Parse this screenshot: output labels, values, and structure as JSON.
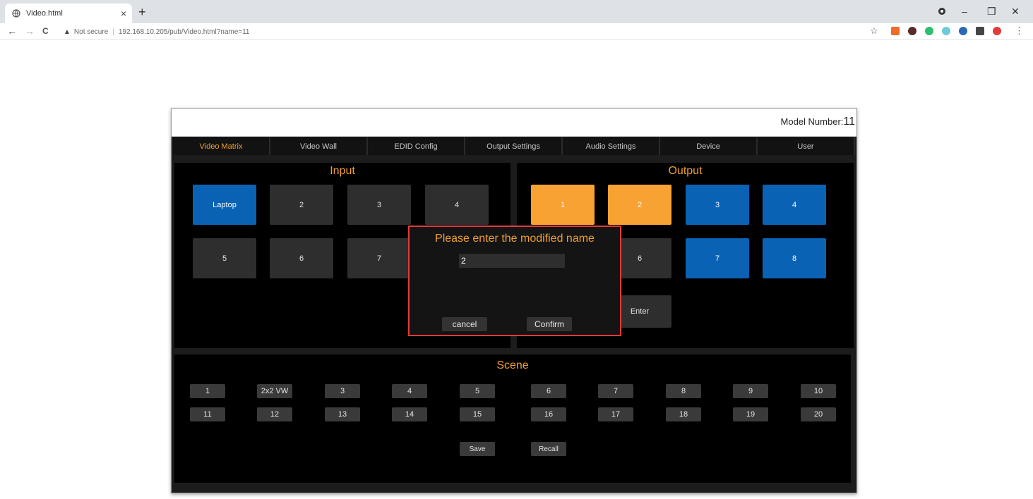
{
  "browser": {
    "tab_title": "Video.html",
    "tab_close": "×",
    "new_tab": "+",
    "not_secure": "Not secure",
    "url": "192.168.10.205/pub/Video.html?name=11",
    "back": "←",
    "forward": "→",
    "reload": "C",
    "minimize": "–",
    "restore": "❐",
    "close": "✕",
    "star": "☆",
    "menu": "⋮"
  },
  "header": {
    "model_label": "Model Number:",
    "model_number": "11"
  },
  "nav": {
    "items": [
      "Video Matrix",
      "Video Wall",
      "EDID Config",
      "Output Settings",
      "Audio Settings",
      "Device",
      "User"
    ],
    "active": "Video Matrix"
  },
  "input": {
    "title": "Input",
    "tiles": [
      "Laptop",
      "2",
      "3",
      "4",
      "5",
      "6",
      "7"
    ]
  },
  "output": {
    "title": "Output",
    "tiles": [
      "1",
      "2",
      "3",
      "4",
      "6",
      "7",
      "8"
    ],
    "enter_label": "Enter"
  },
  "scene": {
    "title": "Scene",
    "row1": [
      "1",
      "2x2 VW",
      "3",
      "4",
      "5",
      "6",
      "7",
      "8",
      "9",
      "10"
    ],
    "row2": [
      "11",
      "12",
      "13",
      "14",
      "15",
      "16",
      "17",
      "18",
      "19",
      "20"
    ],
    "save_label": "Save",
    "recall_label": "Recall"
  },
  "dialog": {
    "title": "Please enter the modified name",
    "input_value": "2",
    "cancel_label": "cancel",
    "confirm_label": "Confirm"
  },
  "colors": {
    "accent_orange": "#f0a030",
    "selected_blue": "#0a62b5",
    "selected_orange": "#f7a232",
    "dialog_border": "#e33a3a"
  }
}
